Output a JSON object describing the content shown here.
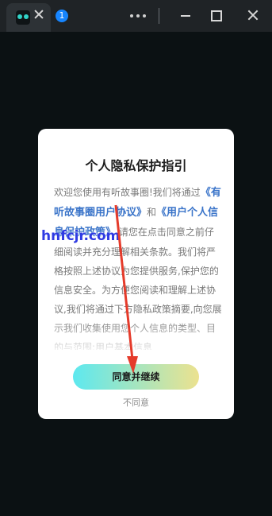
{
  "titlebar": {
    "tab_count": "1"
  },
  "dialog": {
    "title": "个人隐私保护指引",
    "content": {
      "intro": "欢迎您使用有听故事圈!我们将通过",
      "link_user_agreement": "《有听故事圈用户协议》",
      "and": "和",
      "link_privacy_policy": "《用户个人信息保护政策》",
      "body": ",请您在点击同意之前仔细阅读并充分理解相关条款。我们将严格按照上述协议为您提供服务,保护您的信息安全。为方便您阅读和理解上述协议,我们将通过下方隐私政策摘要,向您展示我们收集使用您个人信息的类型、目的与范围:用户基本信息"
    },
    "confirm_label": "同意并继续",
    "decline_label": "不同意"
  },
  "watermark": "hnfcjr.com",
  "colors": {
    "accent_link": "#3a74c9",
    "button_gradient_start": "#5de8ef",
    "button_gradient_end": "#ece28f",
    "annotation_arrow": "#e53b2b"
  }
}
